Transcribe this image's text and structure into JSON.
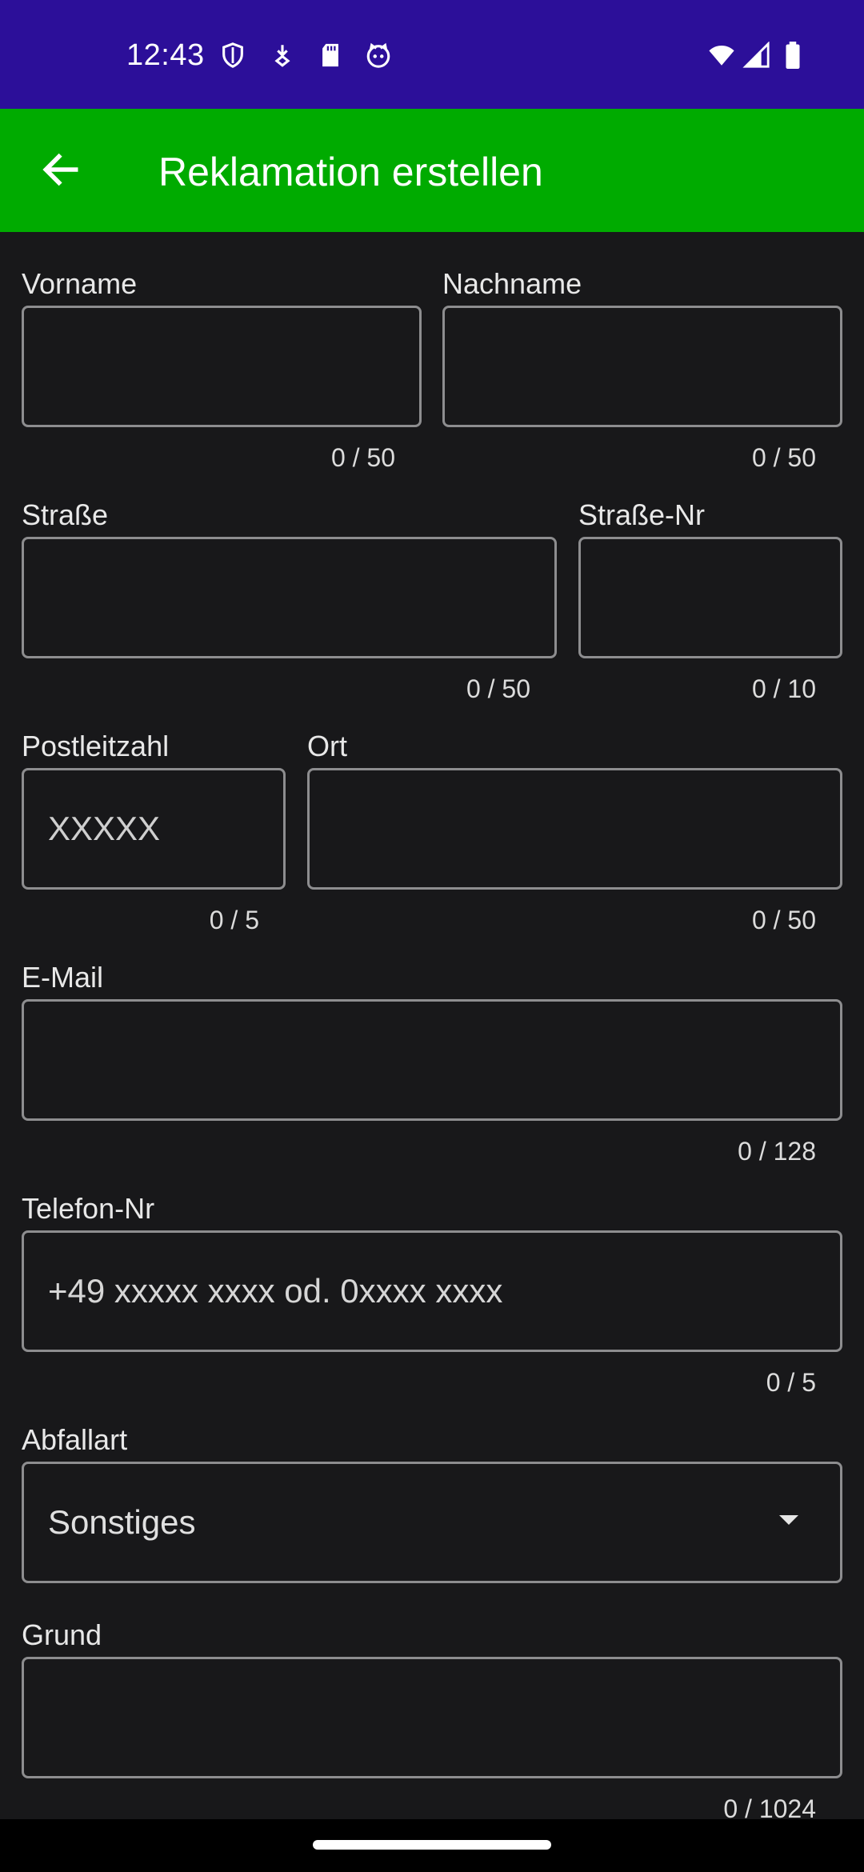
{
  "status_bar": {
    "time": "12:43",
    "left_icons": [
      "shield-icon",
      "download-icon",
      "sd-card-icon",
      "cat-face-icon"
    ],
    "right_icons": [
      "wifi-icon",
      "signal-icon",
      "battery-icon"
    ],
    "background": "#2c0f99"
  },
  "app_bar": {
    "title": "Reklamation erstellen",
    "back_icon": "arrow-back-icon",
    "background": "#00ab00"
  },
  "form": {
    "vorname": {
      "label": "Vorname",
      "value": "",
      "counter": "0 / 50"
    },
    "nachname": {
      "label": "Nachname",
      "value": "",
      "counter": "0 / 50"
    },
    "strasse": {
      "label": "Straße",
      "value": "",
      "counter": "0 / 50"
    },
    "strasse_nr": {
      "label": "Straße-Nr",
      "value": "",
      "counter": "0 / 10"
    },
    "plz": {
      "label": "Postleitzahl",
      "placeholder": "XXXXX",
      "counter": "0 / 5"
    },
    "ort": {
      "label": "Ort",
      "value": "",
      "counter": "0 / 50"
    },
    "email": {
      "label": "E-Mail",
      "value": "",
      "counter": "0 / 128"
    },
    "telefon": {
      "label": "Telefon-Nr",
      "placeholder": "+49 xxxxx xxxx od. 0xxxx xxxx",
      "counter": "0 / 5"
    },
    "abfallart": {
      "label": "Abfallart",
      "selected": "Sonstiges"
    },
    "grund": {
      "label": "Grund",
      "value": "",
      "counter": "0 / 1024"
    }
  },
  "colors": {
    "background": "#18181a",
    "field_border": "#8d8d8f",
    "text": "#e6e6e6"
  }
}
